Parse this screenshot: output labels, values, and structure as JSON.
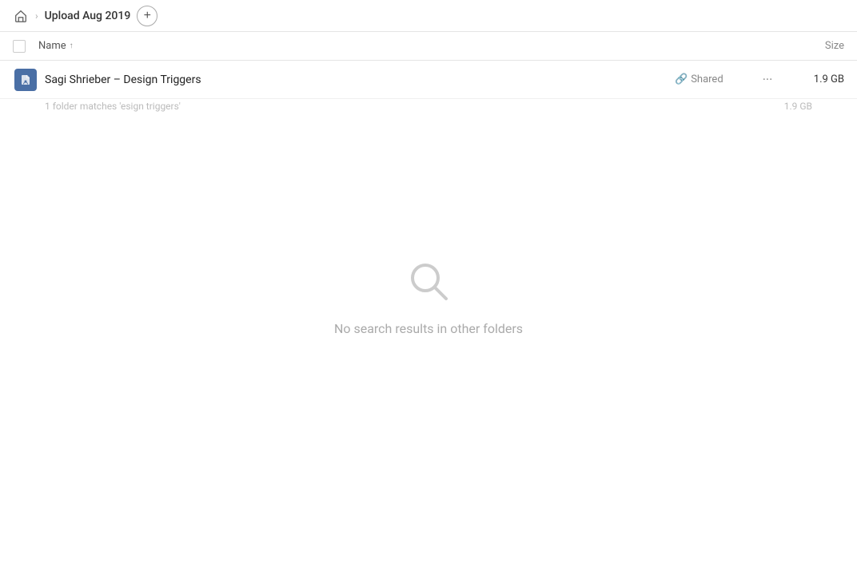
{
  "topbar": {
    "home_icon": "🏠",
    "breadcrumb_separator": "›",
    "breadcrumb_label": "Upload Aug 2019",
    "add_button_label": "+"
  },
  "table": {
    "col_name_label": "Name",
    "col_sort_arrow": "↑",
    "col_size_label": "Size"
  },
  "file_row": {
    "name": "Sagi Shrieber – Design Triggers",
    "shared_label": "Shared",
    "size": "1.9 GB",
    "matches_text": "1 folder matches 'esign triggers'",
    "matches_size": "1.9 GB"
  },
  "empty_state": {
    "label": "No search results in other folders"
  }
}
